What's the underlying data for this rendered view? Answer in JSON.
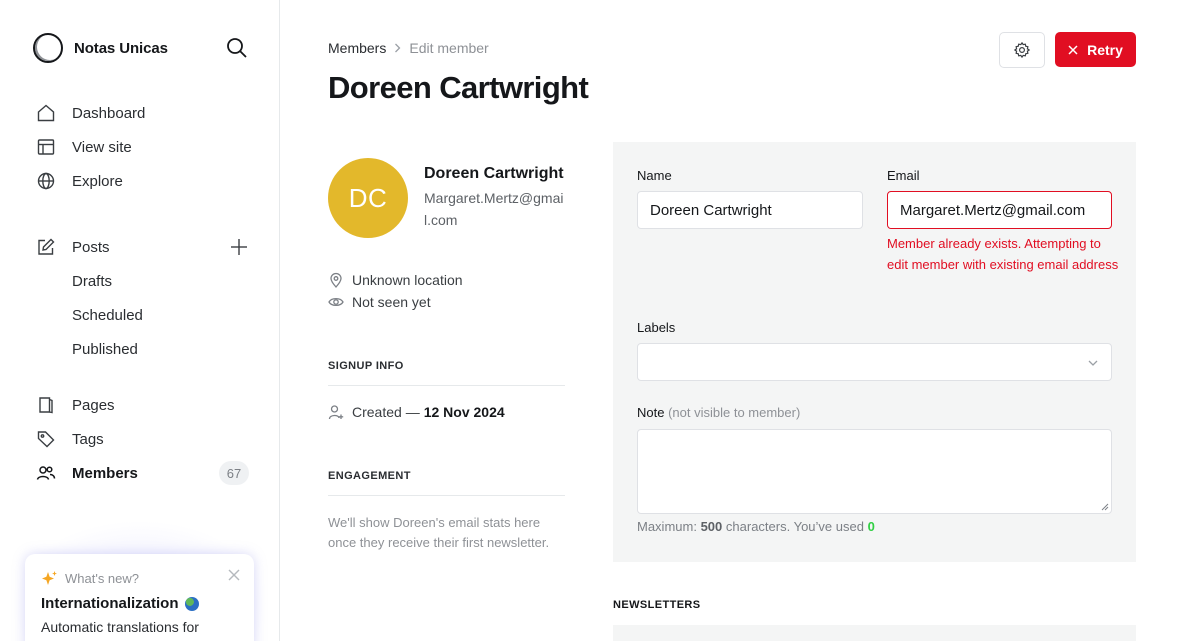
{
  "sidebar": {
    "brand": "Notas Unicas",
    "items": [
      {
        "label": "Dashboard",
        "icon": "home-icon"
      },
      {
        "label": "View site",
        "icon": "layout-icon"
      },
      {
        "label": "Explore",
        "icon": "globe-icon"
      },
      {
        "label": "Posts",
        "icon": "edit-icon"
      },
      {
        "label": "Drafts"
      },
      {
        "label": "Scheduled"
      },
      {
        "label": "Published"
      },
      {
        "label": "Pages",
        "icon": "page-icon"
      },
      {
        "label": "Tags",
        "icon": "tag-icon"
      },
      {
        "label": "Members",
        "icon": "members-icon",
        "count": "67"
      }
    ],
    "whatsnew": {
      "heading": "What's new?",
      "title": "Internationalization",
      "text": "Automatic translations for"
    }
  },
  "header": {
    "breadcrumb_parent": "Members",
    "breadcrumb_current": "Edit member",
    "title": "Doreen Cartwright",
    "retry_label": "Retry"
  },
  "profile": {
    "initials": "DC",
    "name": "Doreen Cartwright",
    "email": "Margaret.Mertz@gmail.com",
    "location": "Unknown location",
    "seen": "Not seen yet",
    "signup_heading": "SIGNUP INFO",
    "created_label": "Created —",
    "created_date": "12 Nov 2024",
    "engagement_heading": "ENGAGEMENT",
    "engagement_text": "We'll show Doreen's email stats here once they receive their first newsletter."
  },
  "form": {
    "name_label": "Name",
    "name_value": "Doreen Cartwright",
    "email_label": "Email",
    "email_value": "Margaret.Mertz@gmail.com",
    "email_error": "Member already exists. Attempting to edit member with existing email address",
    "labels_label": "Labels",
    "note_label": "Note",
    "note_hint": "(not visible to member)",
    "counter_prefix": "Maximum:",
    "counter_max": "500",
    "counter_mid": "characters. You’ve used",
    "counter_used": "0"
  },
  "newsletters_heading": "NEWSLETTERS",
  "colors": {
    "accent_red": "#e10e22",
    "avatar": "#e3b82b",
    "success_green": "#30cf43"
  }
}
